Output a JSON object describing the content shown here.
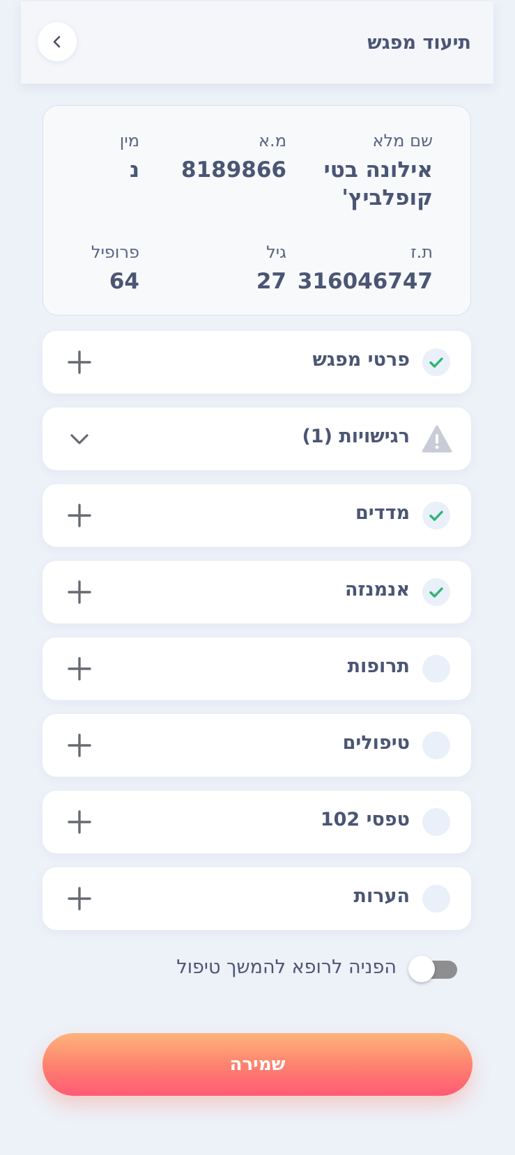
{
  "header": {
    "title": "תיעוד מפגש",
    "back_icon": "chevron-left-icon"
  },
  "patient": {
    "full_name_label": "שם מלא",
    "full_name": "אילונה בטי קופלביץ'",
    "ma_label": "מ.א",
    "ma": "8189866",
    "gender_label": "מין",
    "gender": "נ",
    "id_label": "ת.ז",
    "id": "316046747",
    "age_label": "גיל",
    "age": "27",
    "profile_label": "פרופיל",
    "profile": "64"
  },
  "sections": [
    {
      "label": "פרטי מפגש",
      "status": "done",
      "status_icon": "check-icon",
      "action_icon": "plus-icon"
    },
    {
      "label": "רגישויות (1)",
      "status": "warning",
      "status_icon": "warning-icon",
      "action_icon": "chevron-down-icon"
    },
    {
      "label": "מדדים",
      "status": "done",
      "status_icon": "check-icon",
      "action_icon": "plus-icon"
    },
    {
      "label": "אנמנזה",
      "status": "done",
      "status_icon": "check-icon",
      "action_icon": "plus-icon"
    },
    {
      "label": "תרופות",
      "status": "empty",
      "status_icon": "empty-circle-icon",
      "action_icon": "plus-icon"
    },
    {
      "label": "טיפולים",
      "status": "empty",
      "status_icon": "empty-circle-icon",
      "action_icon": "plus-icon"
    },
    {
      "label": "טפסי 102",
      "status": "empty",
      "status_icon": "empty-circle-icon",
      "action_icon": "plus-icon"
    },
    {
      "label": "הערות",
      "status": "empty",
      "status_icon": "empty-circle-icon",
      "action_icon": "plus-icon"
    }
  ],
  "referral": {
    "label": "הפניה לרופא להמשך טיפול",
    "enabled": false
  },
  "save_label": "שמירה",
  "colors": {
    "background": "#edf1f8",
    "text": "#4b5574",
    "check": "#2bb673",
    "warning": "#c9ccd6",
    "save_gradient_top": "#fdb47c",
    "save_gradient_bottom": "#ff5a74"
  }
}
